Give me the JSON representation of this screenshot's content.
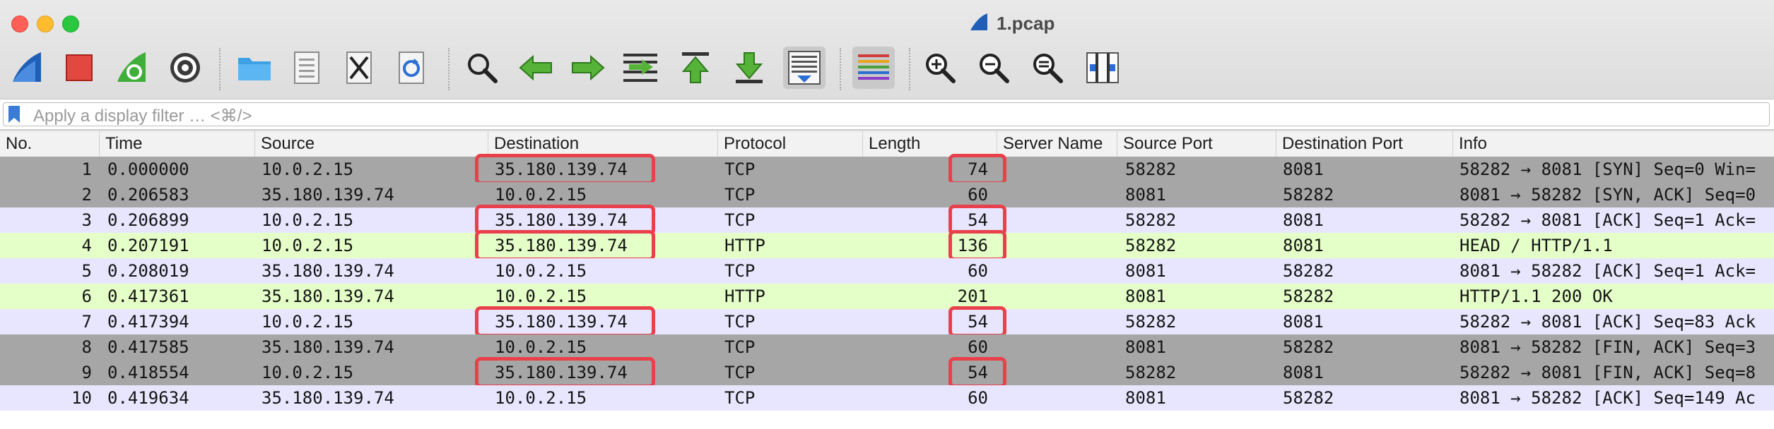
{
  "window": {
    "title": "1.pcap"
  },
  "toolbar": {
    "buttons": [
      {
        "icon": "shark-fin-start-icon"
      },
      {
        "icon": "stop-square-icon"
      },
      {
        "icon": "restart-capture-icon"
      },
      {
        "icon": "capture-options-gear-icon"
      },
      {
        "icon": "open-folder-icon"
      },
      {
        "icon": "save-file-icon"
      },
      {
        "icon": "close-file-icon"
      },
      {
        "icon": "reload-file-icon"
      },
      {
        "icon": "find-magnifier-icon"
      },
      {
        "icon": "go-back-arrow-icon"
      },
      {
        "icon": "go-forward-arrow-icon"
      },
      {
        "icon": "go-to-packet-icon"
      },
      {
        "icon": "go-first-packet-icon"
      },
      {
        "icon": "go-last-packet-icon"
      },
      {
        "icon": "auto-scroll-icon"
      },
      {
        "icon": "colorize-icon"
      },
      {
        "icon": "zoom-in-icon"
      },
      {
        "icon": "zoom-out-icon"
      },
      {
        "icon": "zoom-normal-icon"
      },
      {
        "icon": "resize-columns-icon"
      }
    ]
  },
  "filter": {
    "placeholder": "Apply a display filter … <⌘/>"
  },
  "columns": [
    "No.",
    "Time",
    "Source",
    "Destination",
    "Protocol",
    "Length",
    "Server Name",
    "Source Port",
    "Destination Port",
    "Info"
  ],
  "packets": [
    {
      "no": "1",
      "time": "0.000000",
      "source": "10.0.2.15",
      "destination": "35.180.139.74",
      "protocol": "TCP",
      "length": "74",
      "server_name": "",
      "src_port": "58282",
      "dst_port": "8081",
      "info": "58282 → 8081 [SYN] Seq=0 Win=",
      "color": "#a6a6a6",
      "highlight_destination": true,
      "highlight_length": true
    },
    {
      "no": "2",
      "time": "0.206583",
      "source": "35.180.139.74",
      "destination": "10.0.2.15",
      "protocol": "TCP",
      "length": "60",
      "server_name": "",
      "src_port": "8081",
      "dst_port": "58282",
      "info": "8081 → 58282 [SYN, ACK] Seq=0",
      "color": "#a6a6a6",
      "highlight_destination": false,
      "highlight_length": false
    },
    {
      "no": "3",
      "time": "0.206899",
      "source": "10.0.2.15",
      "destination": "35.180.139.74",
      "protocol": "TCP",
      "length": "54",
      "server_name": "",
      "src_port": "58282",
      "dst_port": "8081",
      "info": "58282 → 8081 [ACK] Seq=1 Ack=",
      "color": "#e7e6fe",
      "highlight_destination": true,
      "highlight_length": true
    },
    {
      "no": "4",
      "time": "0.207191",
      "source": "10.0.2.15",
      "destination": "35.180.139.74",
      "protocol": "HTTP",
      "length": "136",
      "server_name": "",
      "src_port": "58282",
      "dst_port": "8081",
      "info": "HEAD / HTTP/1.1",
      "color": "#e4ffc7",
      "highlight_destination": true,
      "highlight_length": true
    },
    {
      "no": "5",
      "time": "0.208019",
      "source": "35.180.139.74",
      "destination": "10.0.2.15",
      "protocol": "TCP",
      "length": "60",
      "server_name": "",
      "src_port": "8081",
      "dst_port": "58282",
      "info": "8081 → 58282 [ACK] Seq=1 Ack=",
      "color": "#e7e6fe",
      "highlight_destination": false,
      "highlight_length": false
    },
    {
      "no": "6",
      "time": "0.417361",
      "source": "35.180.139.74",
      "destination": "10.0.2.15",
      "protocol": "HTTP",
      "length": "201",
      "server_name": "",
      "src_port": "8081",
      "dst_port": "58282",
      "info": "HTTP/1.1 200 OK",
      "color": "#e4ffc7",
      "highlight_destination": false,
      "highlight_length": false
    },
    {
      "no": "7",
      "time": "0.417394",
      "source": "10.0.2.15",
      "destination": "35.180.139.74",
      "protocol": "TCP",
      "length": "54",
      "server_name": "",
      "src_port": "58282",
      "dst_port": "8081",
      "info": "58282 → 8081 [ACK] Seq=83 Ack",
      "color": "#e7e6fe",
      "highlight_destination": true,
      "highlight_length": true
    },
    {
      "no": "8",
      "time": "0.417585",
      "source": "35.180.139.74",
      "destination": "10.0.2.15",
      "protocol": "TCP",
      "length": "60",
      "server_name": "",
      "src_port": "8081",
      "dst_port": "58282",
      "info": "8081 → 58282 [FIN, ACK] Seq=3",
      "color": "#a6a6a6",
      "highlight_destination": false,
      "highlight_length": false
    },
    {
      "no": "9",
      "time": "0.418554",
      "source": "10.0.2.15",
      "destination": "35.180.139.74",
      "protocol": "TCP",
      "length": "54",
      "server_name": "",
      "src_port": "58282",
      "dst_port": "8081",
      "info": "58282 → 8081 [FIN, ACK] Seq=8",
      "color": "#a6a6a6",
      "highlight_destination": true,
      "highlight_length": true
    },
    {
      "no": "10",
      "time": "0.419634",
      "source": "35.180.139.74",
      "destination": "10.0.2.15",
      "protocol": "TCP",
      "length": "60",
      "server_name": "",
      "src_port": "8081",
      "dst_port": "58282",
      "info": "8081 → 58282 [ACK] Seq=149 Ac",
      "color": "#e7e6fe",
      "highlight_destination": false,
      "highlight_length": false
    }
  ],
  "colors": {
    "highlight_box": "#e8414b"
  }
}
